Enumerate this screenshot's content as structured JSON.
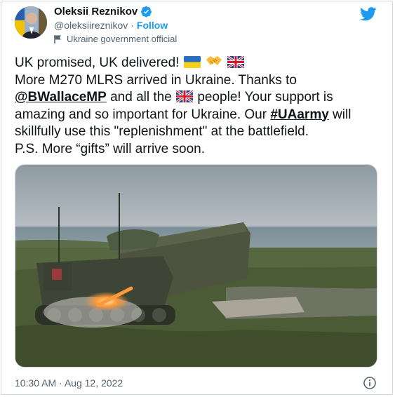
{
  "author": {
    "name": "Oleksii Reznikov",
    "handle": "@oleksiireznikov",
    "separator": "·",
    "follow_label": "Follow",
    "account_label": "Ukraine government official"
  },
  "tweet": {
    "line1": "UK promised, UK delivered!",
    "line2": "More M270 MLRS arrived in Ukraine. Thanks to",
    "line3_mention": "@BWallaceMP",
    "line3_a": " and all the ",
    "line3_b": " people! Your support is",
    "line4_a": "amazing and so important for Ukraine. Our ",
    "line4_hashtag": "#UAarmy",
    "line4_b": " will",
    "line5": "skillfully use this \"replenishment\" at the battlefield.",
    "line6": "P.S. More “gifts” will arrive soon."
  },
  "emojis": [
    "ukraine-flag",
    "handshake",
    "uk-flag"
  ],
  "timestamp": "10:30 AM · Aug 12, 2022",
  "colors": {
    "accent": "#1d9bf0",
    "muted": "#536471",
    "text": "#0f1419",
    "border": "#cfd9de"
  }
}
